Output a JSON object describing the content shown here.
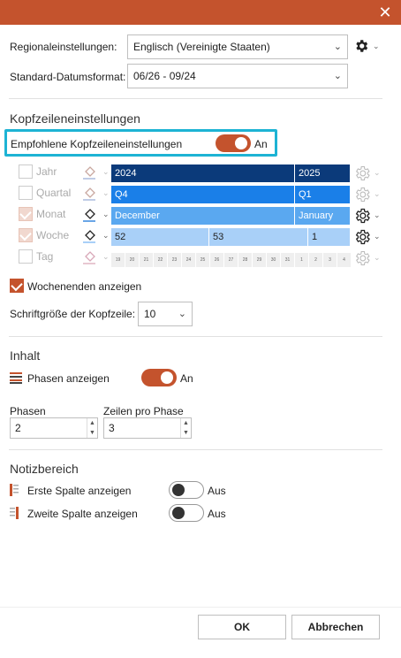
{
  "window": {
    "close_glyph": "✕"
  },
  "regional": {
    "label": "Regionaleinstellungen:",
    "value": "Englisch (Vereinigte Staaten)",
    "date_label": "Standard-Datumsformat:",
    "date_value": "06/26 - 09/24"
  },
  "header_settings": {
    "title": "Kopfzeileneinstellungen",
    "recommended_label": "Empfohlene Kopfzeileneinstellungen",
    "recommended_state": "An",
    "rows": [
      {
        "label": "Jahr",
        "bars": [
          "2024",
          "2025"
        ]
      },
      {
        "label": "Quartal",
        "bars": [
          "Q4",
          "Q1"
        ]
      },
      {
        "label": "Monat",
        "bars": [
          "December",
          "January"
        ]
      },
      {
        "label": "Woche",
        "bars": [
          "52",
          "53",
          "1"
        ]
      },
      {
        "label": "Tag",
        "days": [
          "19",
          "20",
          "21",
          "22",
          "23",
          "24",
          "25",
          "26",
          "27",
          "28",
          "29",
          "30",
          "31",
          "1",
          "2",
          "3",
          "4"
        ]
      }
    ],
    "weekends_label": "Wochenenden anzeigen",
    "font_size_label": "Schriftgröße der Kopfzeile:",
    "font_size_value": "10"
  },
  "content": {
    "title": "Inhalt",
    "phases_label": "Phasen anzeigen",
    "phases_state": "An",
    "phases_field_label": "Phasen",
    "phases_value": "2",
    "rows_per_phase_label": "Zeilen pro Phase",
    "rows_per_phase_value": "3"
  },
  "notes": {
    "title": "Notizbereich",
    "first_col_label": "Erste Spalte anzeigen",
    "first_col_state": "Aus",
    "second_col_label": "Zweite Spalte anzeigen",
    "second_col_state": "Aus"
  },
  "footer": {
    "ok_label": "OK",
    "cancel_label": "Abbrechen"
  },
  "colors": {
    "accent": "#c4532d",
    "highlight": "#1db3d4",
    "year_bar": "#0b3a7a",
    "quarter_bar": "#1a7fe8",
    "month_bar": "#5aa8f0",
    "week_bar": "#a9d0f8"
  }
}
